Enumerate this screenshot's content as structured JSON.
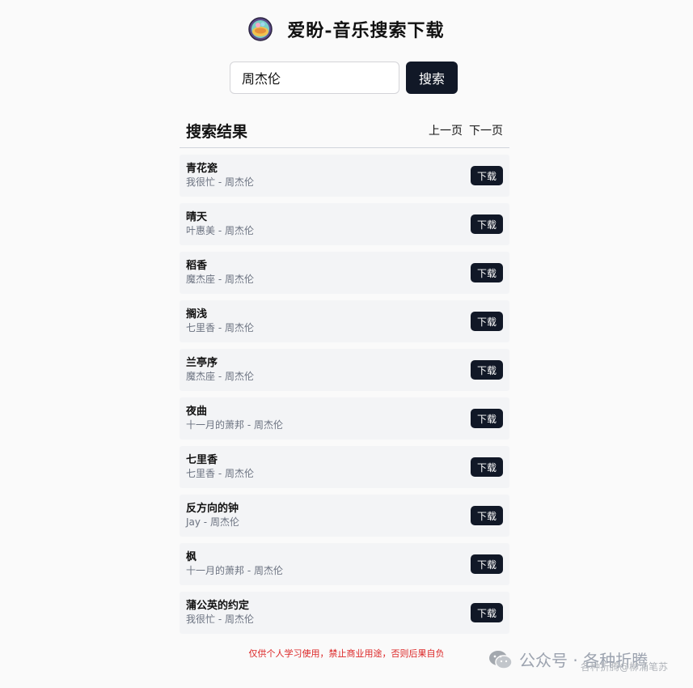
{
  "header": {
    "title": "爱盼-音乐搜索下载",
    "logo_icon": "vinyl-gem-logo-icon"
  },
  "search": {
    "value": "周杰伦",
    "placeholder": "",
    "button_label": "搜索"
  },
  "results": {
    "title": "搜索结果",
    "prev_label": "上一页",
    "next_label": "下一页",
    "download_label": "下载",
    "items": [
      {
        "name": "青花瓷",
        "meta": "我很忙 - 周杰伦"
      },
      {
        "name": "晴天",
        "meta": "叶惠美 - 周杰伦"
      },
      {
        "name": "稻香",
        "meta": "魔杰座 - 周杰伦"
      },
      {
        "name": "搁浅",
        "meta": "七里香 - 周杰伦"
      },
      {
        "name": "兰亭序",
        "meta": "魔杰座 - 周杰伦"
      },
      {
        "name": "夜曲",
        "meta": "十一月的萧邦 - 周杰伦"
      },
      {
        "name": "七里香",
        "meta": "七里香 - 周杰伦"
      },
      {
        "name": "反方向的钟",
        "meta": "Jay - 周杰伦"
      },
      {
        "name": "枫",
        "meta": "十一月的萧邦 - 周杰伦"
      },
      {
        "name": "蒲公英的约定",
        "meta": "我很忙 - 周杰伦"
      }
    ]
  },
  "footer": {
    "note": "仅供个人学习使用，禁止商业用途，否则后果自负"
  },
  "watermark": {
    "text": "公众号 · 各种折腾",
    "icon": "wechat-icon",
    "subtext": "各种折腾@柳涌笔苏"
  },
  "colors": {
    "primary_button": "#111827",
    "item_background": "#f3f4f6",
    "footer_note": "#dc2626",
    "page_background": "#fafafa"
  }
}
